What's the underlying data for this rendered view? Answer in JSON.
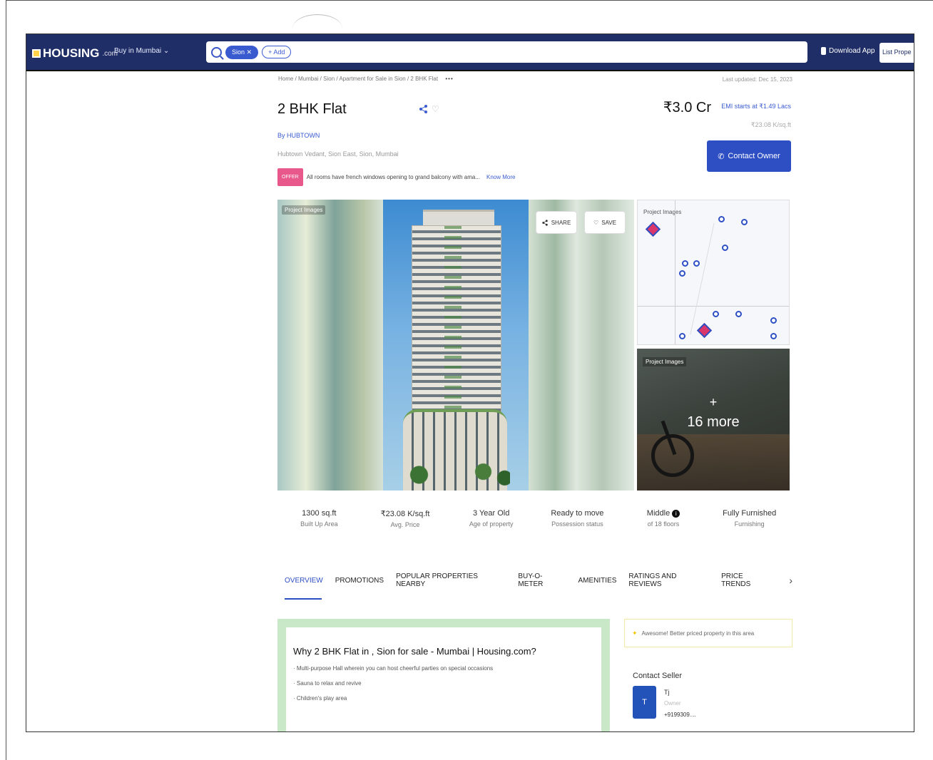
{
  "header": {
    "logo_text": "HOUSING",
    "logo_suffix": ".com",
    "city_select": "Buy in Mumbai",
    "search_chip": "Sion ✕",
    "add_chip": "+ Add",
    "download_app": "Download App",
    "list_property": "List Prope"
  },
  "breadcrumb": {
    "path": "Home / Mumbai / Sion / Apartment for Sale in Sion / 2 BHK Flat",
    "more": "•••"
  },
  "last_updated": "Last updated: Dec 15, 2023",
  "listing": {
    "title": "2 BHK Flat",
    "price": "₹3.0 Cr",
    "emi": "EMI starts at ₹1.49 Lacs",
    "price_per_sqft": "₹23.08 K/sq.ft",
    "developer_prefix": "By ",
    "developer_name": "HUBTOWN",
    "address": "Hubtown Vedant, Sion East, Sion, Mumbai",
    "contact_button": "Contact Owner",
    "offer_badge": "OFFER",
    "offer_text": "All rooms have french windows opening to grand balcony with ama...",
    "know_more": "Know More"
  },
  "gallery": {
    "main_label": "Project Images",
    "share_label": "SHARE",
    "save_label": "SAVE",
    "map_label": "Project Images",
    "gym_label": "Project Images",
    "more_plus": "+",
    "more_text": "16 more"
  },
  "stats": [
    {
      "value": "1300 sq.ft",
      "label": "Built Up Area"
    },
    {
      "value": "₹23.08 K/sq.ft",
      "label": "Avg. Price"
    },
    {
      "value": "3 Year Old",
      "label": "Age of property"
    },
    {
      "value": "Ready to move",
      "label": "Possession status"
    },
    {
      "value": "Middle",
      "label": "of 18 floors"
    },
    {
      "value": "Fully Furnished",
      "label": "Furnishing"
    }
  ],
  "tabs": [
    "OVERVIEW",
    "PROMOTIONS",
    "POPULAR PROPERTIES NEARBY",
    "BUY-O-METER",
    "AMENITIES",
    "RATINGS AND REVIEWS",
    "PRICE TRENDS"
  ],
  "overview": {
    "heading": "Why 2 BHK Flat in , Sion for sale - Mumbai | Housing.com?",
    "items": [
      "Multi-purpose Hall wherein you can host cheerful parties on special occasions",
      "Sauna to relax and revive",
      "Children's play area"
    ]
  },
  "side_note": "Awesome! Better priced property in this area",
  "seller": {
    "section_title": "Contact Seller",
    "avatar_initial": "T",
    "name": "Tj",
    "role": "Owner",
    "phone": "+9199309...."
  },
  "colors": {
    "brand_navy": "#1f2e66",
    "accent_blue": "#2e4fc4",
    "offer_pink": "#e8588a",
    "overview_green": "#c9e8c7"
  }
}
